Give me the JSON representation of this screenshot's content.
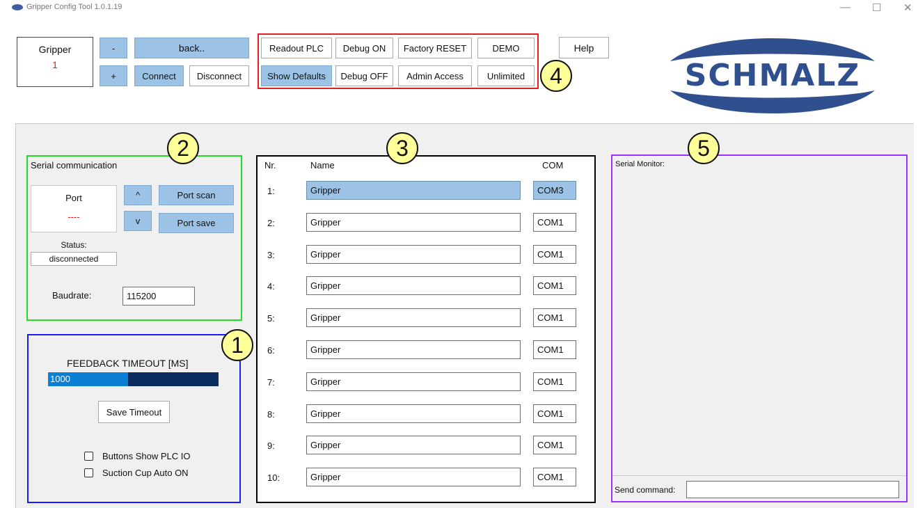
{
  "window": {
    "title": "Gripper Config Tool 1.0.1.19",
    "controls": {
      "minimize": "—",
      "maximize": "☐",
      "close": "✕"
    }
  },
  "toolbar": {
    "gripper_label": "Gripper",
    "gripper_number": "1",
    "minus_label": "-",
    "plus_label": "+",
    "back_label": "back..",
    "connect_label": "Connect",
    "disconnect_label": "Disconnect",
    "readout_plc_label": "Readout PLC",
    "debug_on_label": "Debug ON",
    "factory_reset_label": "Factory RESET",
    "demo_label": "DEMO",
    "show_defaults_label": "Show Defaults",
    "debug_off_label": "Debug OFF",
    "admin_access_label": "Admin Access",
    "unlimited_label": "Unlimited",
    "help_label": "Help"
  },
  "logo": {
    "text": "SCHMALZ",
    "color": "#2f4f8f"
  },
  "annotations": [
    "1",
    "2",
    "3",
    "4",
    "5"
  ],
  "serial": {
    "title": "Serial communication",
    "port_label": "Port",
    "port_value": "----",
    "up_label": "^",
    "down_label": "v",
    "port_scan_label": "Port scan",
    "port_save_label": "Port save",
    "status_label": "Status:",
    "status_value": "disconnected",
    "baudrate_label": "Baudrate:",
    "baudrate_value": "115200"
  },
  "feedback": {
    "title": "FEEDBACK TIMEOUT [MS]",
    "value": "1000",
    "fill_fraction": 0.47,
    "save_label": "Save Timeout",
    "checkbox1_label": "Buttons Show PLC IO",
    "checkbox2_label": "Suction Cup Auto ON"
  },
  "grippers": {
    "headers": {
      "nr": "Nr.",
      "name": "Name",
      "com": "COM"
    },
    "rows": [
      {
        "nr": "1:",
        "name": "Gripper",
        "com": "COM3"
      },
      {
        "nr": "2:",
        "name": "Gripper",
        "com": "COM1"
      },
      {
        "nr": "3:",
        "name": "Gripper",
        "com": "COM1"
      },
      {
        "nr": "4:",
        "name": "Gripper",
        "com": "COM1"
      },
      {
        "nr": "5:",
        "name": "Gripper",
        "com": "COM1"
      },
      {
        "nr": "6:",
        "name": "Gripper",
        "com": "COM1"
      },
      {
        "nr": "7:",
        "name": "Gripper",
        "com": "COM1"
      },
      {
        "nr": "8:",
        "name": "Gripper",
        "com": "COM1"
      },
      {
        "nr": "9:",
        "name": "Gripper",
        "com": "COM1"
      },
      {
        "nr": "10:",
        "name": "Gripper",
        "com": "COM1"
      }
    ]
  },
  "monitor": {
    "title": "Serial Monitor:",
    "send_label": "Send command:",
    "send_value": ""
  },
  "colors": {
    "serial_border": "#22dd22",
    "feedback_border": "#1a1aff",
    "grippers_border": "#000000",
    "toolbar_border": "#e02020",
    "monitor_border": "#9b30ff",
    "button_blue": "#9cc3e6",
    "progress_fill": "#0a7fd4",
    "progress_track": "#0b2c5e"
  }
}
